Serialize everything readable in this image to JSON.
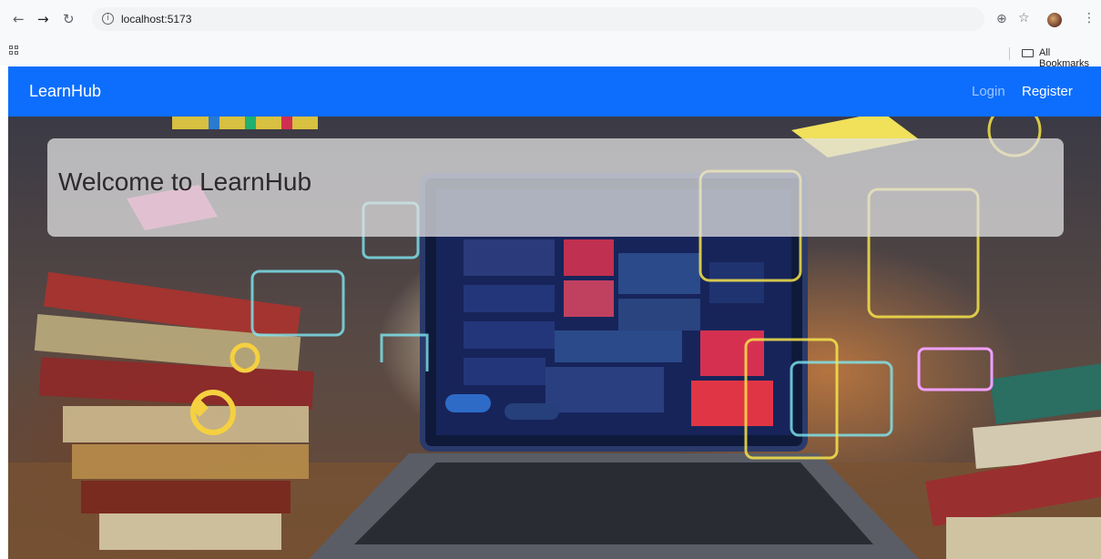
{
  "browser": {
    "url": "localhost:5173",
    "bookmarks_label": "All Bookmarks"
  },
  "navbar": {
    "brand": "LearnHub",
    "login": "Login",
    "register": "Register",
    "color": "#0d6efd"
  },
  "hero": {
    "title": "Welcome to LearnHub",
    "image_description_icon": "laptop-books-illustration"
  }
}
